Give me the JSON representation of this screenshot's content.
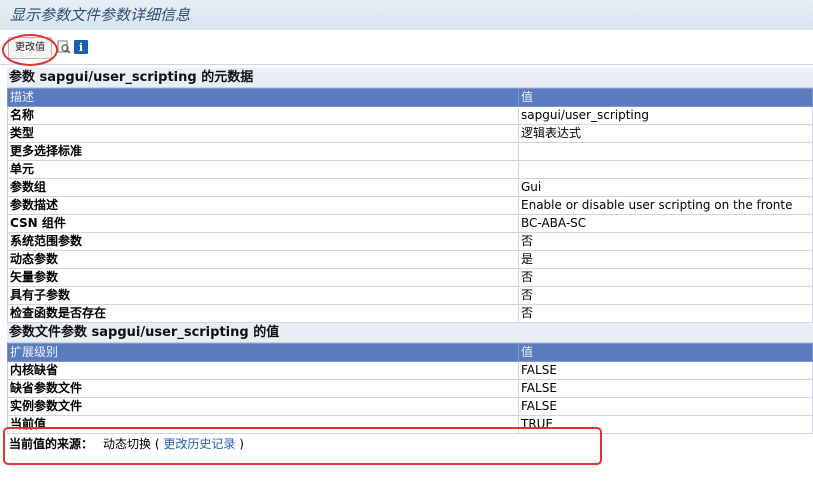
{
  "window": {
    "title": "显示参数文件参数详细信息"
  },
  "toolbar": {
    "change_value_label": "更改值"
  },
  "metadata_section": {
    "title": "参数 sapgui/user_scripting 的元数据",
    "header": {
      "key": "描述",
      "value": "值"
    },
    "rows": [
      {
        "key": "名称",
        "value": "sapgui/user_scripting"
      },
      {
        "key": "类型",
        "value": "逻辑表达式"
      },
      {
        "key": "更多选择标准",
        "value": ""
      },
      {
        "key": "单元",
        "value": ""
      },
      {
        "key": "参数组",
        "value": "Gui"
      },
      {
        "key": "参数描述",
        "value": "Enable or disable user scripting on the fronte"
      },
      {
        "key": "CSN 组件",
        "value": "BC-ABA-SC"
      },
      {
        "key": "系统范围参数",
        "value": "否"
      },
      {
        "key": "动态参数",
        "value": "是"
      },
      {
        "key": "矢量参数",
        "value": "否"
      },
      {
        "key": "具有子参数",
        "value": "否"
      },
      {
        "key": "检查函数是否存在",
        "value": "否"
      }
    ]
  },
  "value_section": {
    "title": "参数文件参数 sapgui/user_scripting 的值",
    "header": {
      "key": "扩展级别",
      "value": "值"
    },
    "rows": [
      {
        "key": "内核缺省",
        "value": "FALSE"
      },
      {
        "key": "缺省参数文件",
        "value": "FALSE"
      },
      {
        "key": "实例参数文件",
        "value": "FALSE"
      },
      {
        "key": "当前值",
        "value": "TRUE"
      }
    ]
  },
  "source": {
    "label": "当前值的来源：",
    "value": "动态切换",
    "link_open": "(",
    "link_text": "更改历史记录",
    "link_close": ")"
  },
  "annotation_color": "#e0322f"
}
